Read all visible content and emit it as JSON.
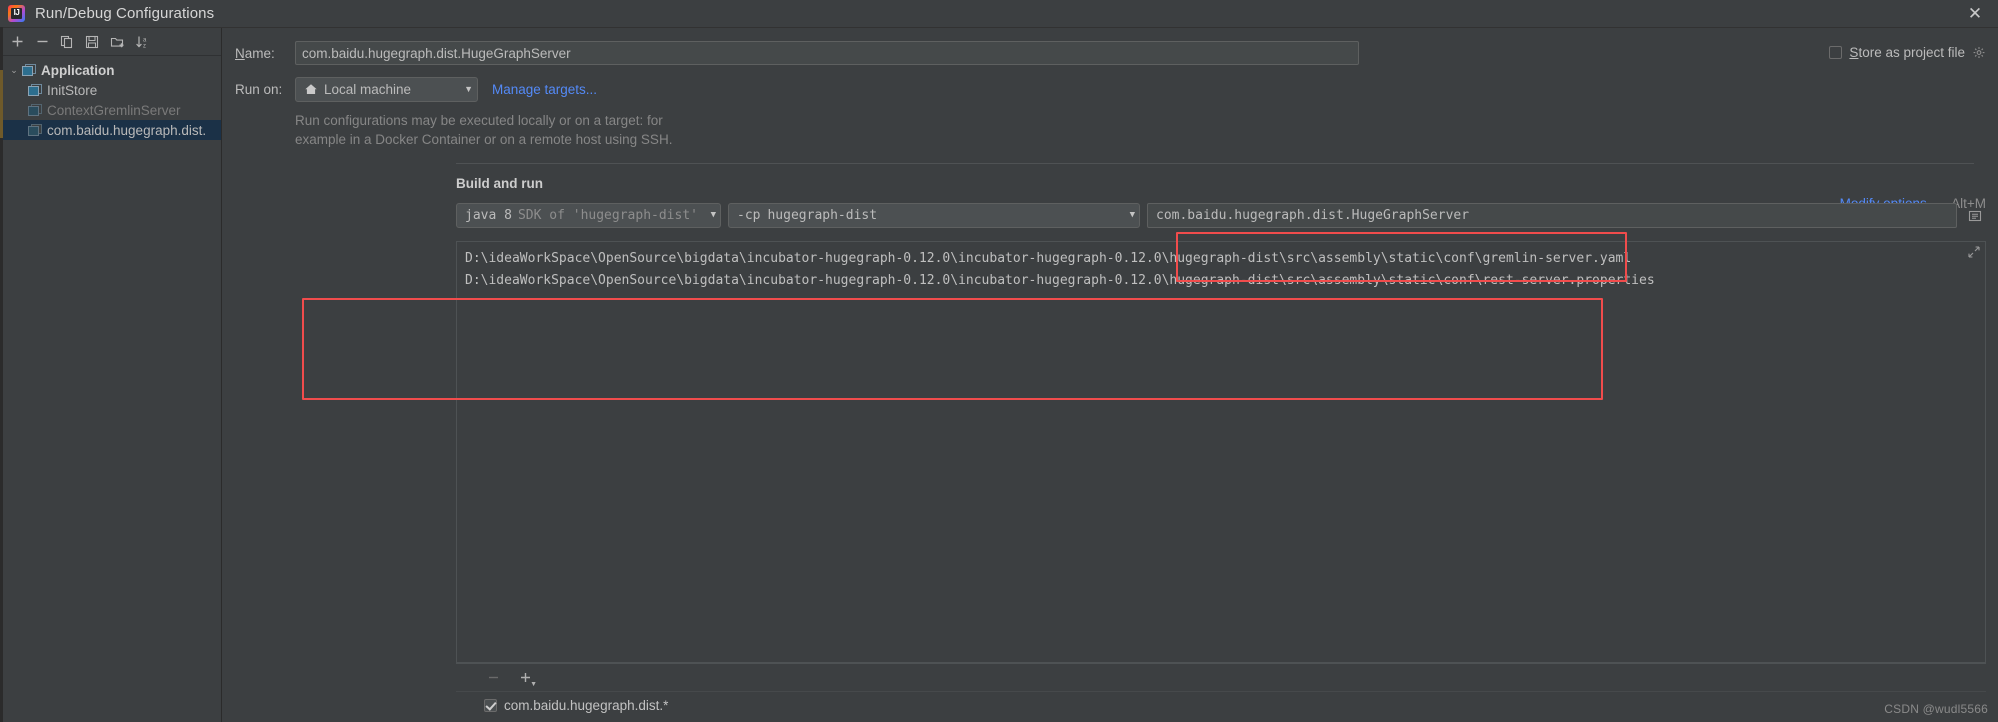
{
  "window": {
    "title": "Run/Debug Configurations",
    "app_icon": "intellij-idea-icon",
    "close_label": "✕"
  },
  "toolbar": {
    "buttons": [
      {
        "name": "add-configuration-button",
        "icon": "plus-icon",
        "label": "+"
      },
      {
        "name": "remove-configuration-button",
        "icon": "minus-icon",
        "label": "−"
      },
      {
        "name": "copy-configuration-button",
        "icon": "copy-icon",
        "label": "copy"
      },
      {
        "name": "save-configuration-button",
        "icon": "save-icon",
        "label": "save"
      },
      {
        "name": "new-folder-button",
        "icon": "folder-add-icon",
        "label": "folder"
      },
      {
        "name": "sort-configurations-button",
        "icon": "sort-alpha-icon",
        "label": "sort"
      }
    ]
  },
  "tree": {
    "group": {
      "label": "Application",
      "icon": "application-group-icon",
      "expanded": true,
      "twisty": "⌄"
    },
    "items": [
      {
        "label": "InitStore",
        "icon": "run-config-icon",
        "state": "normal",
        "selected": false
      },
      {
        "label": "ContextGremlinServer",
        "icon": "run-config-icon",
        "state": "dim",
        "selected": false
      },
      {
        "label": "com.baidu.hugegraph.dist.",
        "icon": "run-config-icon",
        "state": "normal",
        "selected": true
      }
    ]
  },
  "form": {
    "name_label": "Name:",
    "name_label_mnemonic": "N",
    "name_value": "com.baidu.hugegraph.dist.HugeGraphServer",
    "store_as_project_file": {
      "label": "Store as project file",
      "mnemonic": "S",
      "checked": false,
      "gear_icon": "gear-icon"
    },
    "run_on_label": "Run on:",
    "run_on_value": "Local machine",
    "run_on_icon": "home-icon",
    "manage_targets_link": "Manage targets...",
    "hint_line1": "Run configurations may be executed locally or on a target: for",
    "hint_line2": "example in a Docker Container or on a remote host using SSH."
  },
  "build_and_run": {
    "section_title": "Build and run",
    "modify_options_link": "Modify options",
    "modify_options_mnemonic": "M",
    "modify_options_chevron": "⌄",
    "modify_options_shortcut": "Alt+M",
    "jdk_prefix": "java 8",
    "jdk_suffix": "SDK of 'hugegraph-dist'",
    "classpath_prefix": "-cp",
    "classpath_module": "hugegraph-dist",
    "main_class": "com.baidu.hugegraph.dist.HugeGraphServer",
    "main_class_browse_icon": "browse-class-icon",
    "program_arguments": [
      "D:\\ideaWorkSpace\\OpenSource\\bigdata\\incubator-hugegraph-0.12.0\\incubator-hugegraph-0.12.0\\hugegraph-dist\\src\\assembly\\static\\conf\\gremlin-server.yaml",
      "D:\\ideaWorkSpace\\OpenSource\\bigdata\\incubator-hugegraph-0.12.0\\incubator-hugegraph-0.12.0\\hugegraph-dist\\src\\assembly\\static\\conf\\rest-server.properties"
    ],
    "expand_icon": "expand-editor-icon"
  },
  "before_launch": {
    "remove_button_icon": "minus-icon",
    "remove_button_label": "−",
    "add_button_icon": "plus-icon",
    "add_button_label": "+",
    "task_checked": true,
    "task_label": "com.baidu.hugegraph.dist.*"
  },
  "annotations": {
    "main_class_highlight_color": "#f14c4c",
    "program_args_highlight_color": "#f14c4c"
  },
  "watermark": "CSDN @wudl5566"
}
